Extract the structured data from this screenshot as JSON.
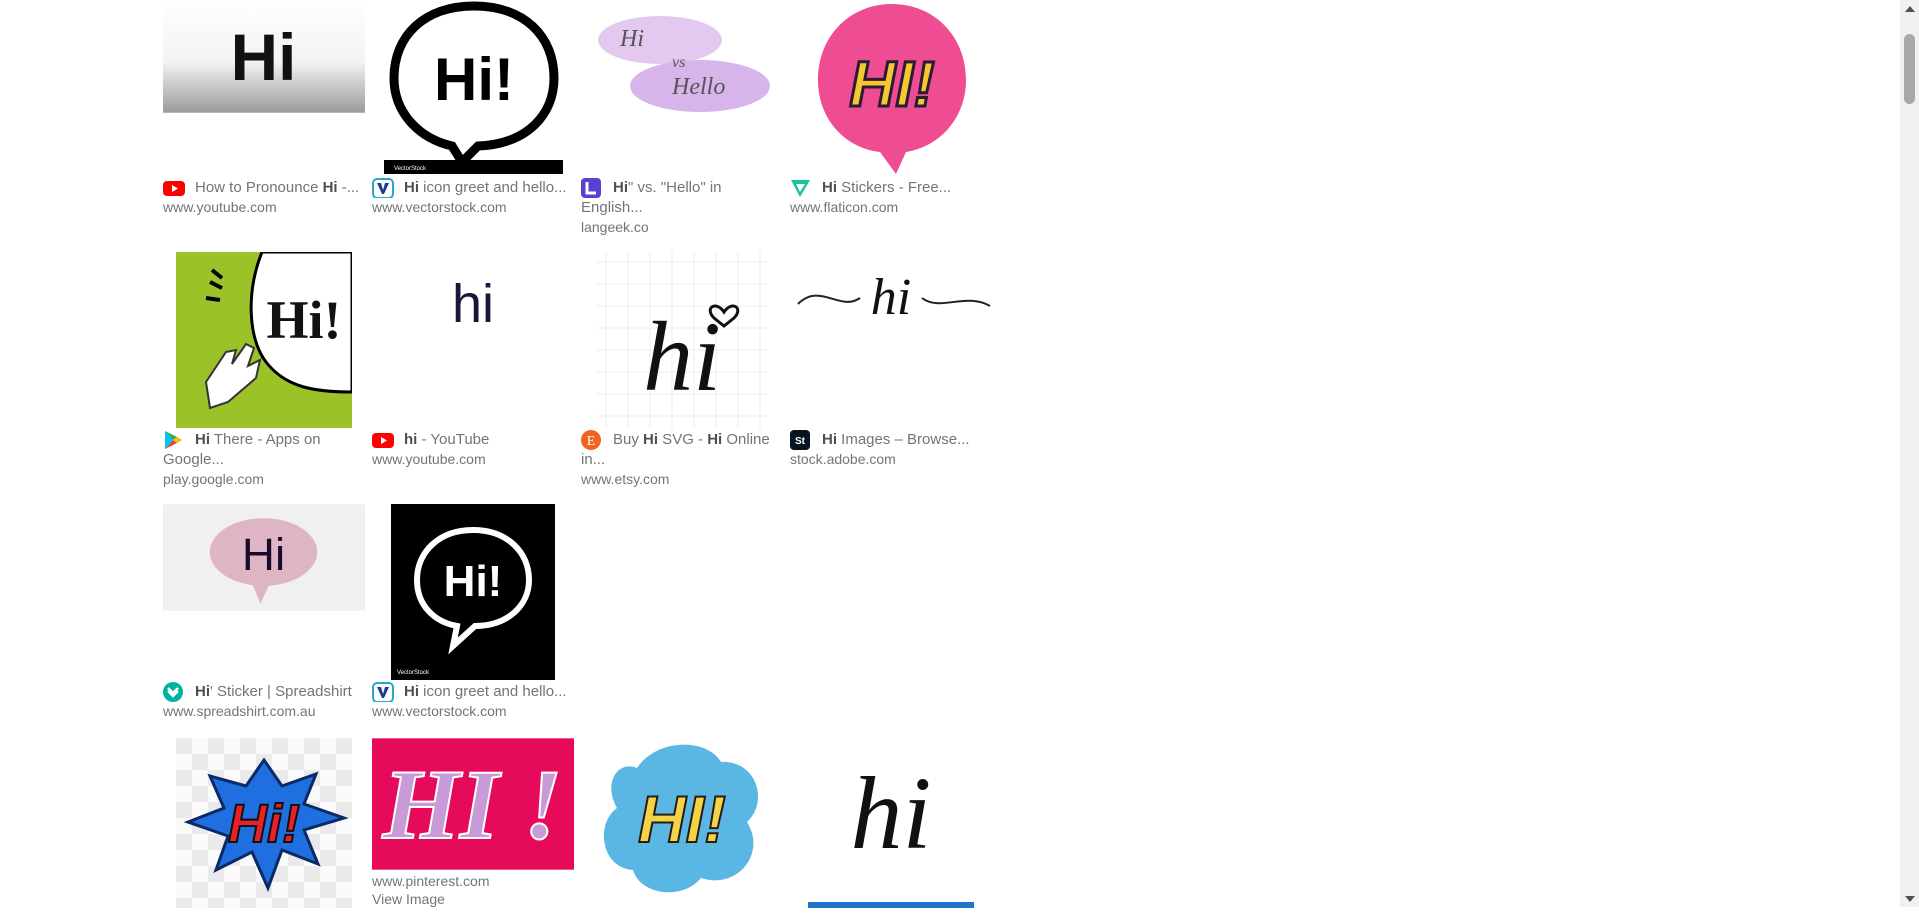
{
  "results": [
    {
      "title_bold": "",
      "title_parts": [
        {
          "t": "How to Pronounce ",
          "b": false
        },
        {
          "t": "Hi",
          "b": true
        },
        {
          "t": " -...",
          "b": false
        }
      ],
      "domain": "www.youtube.com",
      "favicon": "youtube-icon",
      "image_text": "Hi"
    },
    {
      "title_parts": [
        {
          "t": "Hi",
          "b": true
        },
        {
          "t": " icon greet and hello...",
          "b": false
        }
      ],
      "domain": "www.vectorstock.com",
      "favicon": "vectorstock-icon",
      "image_text": "Hi!"
    },
    {
      "title_parts": [
        {
          "t": "Hi",
          "b": true
        },
        {
          "t": "\" vs. \"Hello\" in English...",
          "b": false
        }
      ],
      "domain": "langeek.co",
      "favicon": "langeek-icon",
      "image_text": [
        "Hi",
        "vs",
        "Hello"
      ]
    },
    {
      "title_parts": [
        {
          "t": "Hi",
          "b": true
        },
        {
          "t": " Stickers - Free...",
          "b": false
        }
      ],
      "domain": "www.flaticon.com",
      "favicon": "flaticon-icon",
      "image_text": "HI!"
    },
    {
      "title_parts": [
        {
          "t": "Hi",
          "b": true
        },
        {
          "t": " There - Apps on Google...",
          "b": false
        }
      ],
      "domain": "play.google.com",
      "favicon": "google-play-icon",
      "image_text": "Hi!"
    },
    {
      "title_parts": [
        {
          "t": "hi",
          "b": true
        },
        {
          "t": " - YouTube",
          "b": false
        }
      ],
      "domain": "www.youtube.com",
      "favicon": "youtube-icon",
      "image_text": "hi"
    },
    {
      "title_parts": [
        {
          "t": "Buy ",
          "b": false
        },
        {
          "t": "Hi",
          "b": true
        },
        {
          "t": " SVG - ",
          "b": false
        },
        {
          "t": "Hi",
          "b": true
        },
        {
          "t": " Online in...",
          "b": false
        }
      ],
      "domain": "www.etsy.com",
      "favicon": "etsy-icon",
      "image_text": "hi"
    },
    {
      "title_parts": [
        {
          "t": "Hi",
          "b": true
        },
        {
          "t": " Images – Browse...",
          "b": false
        }
      ],
      "domain": "stock.adobe.com",
      "favicon": "adobe-stock-icon",
      "favicon_text": "St",
      "image_text": "hi"
    },
    {
      "title_parts": [
        {
          "t": "Hi",
          "b": true
        },
        {
          "t": "' Sticker | Spreadshirt",
          "b": false
        }
      ],
      "domain": "www.spreadshirt.com.au",
      "favicon": "spreadshirt-icon",
      "image_text": "Hi"
    },
    {
      "title_parts": [
        {
          "t": "Hi",
          "b": true
        },
        {
          "t": " icon greet and hello...",
          "b": false
        }
      ],
      "domain": "www.vectorstock.com",
      "favicon": "vectorstock-icon",
      "image_text": "Hi!"
    },
    {
      "image_text": "Hi!"
    },
    {
      "domain": "www.pinterest.com",
      "view_label": "View Image",
      "image_text": "HI !"
    },
    {
      "image_text": "HI!"
    },
    {
      "image_text": "hi"
    }
  ],
  "colors": {
    "caption": "#70757a",
    "bold": "#4d5156",
    "youtube": "#ff0000",
    "flaticon": "#17c2a1",
    "scroll_thumb": "#a8a8a8"
  }
}
